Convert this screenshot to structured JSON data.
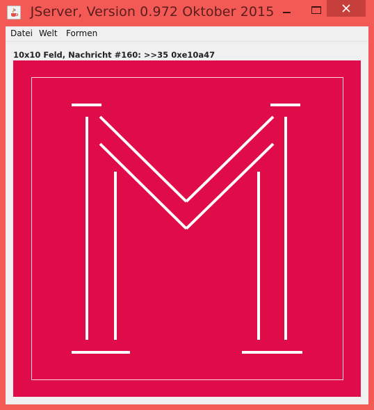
{
  "window": {
    "title": "JServer, Version 0.972 Oktober 2015",
    "icon": "java-cup-icon",
    "controls": [
      "minimize-icon",
      "maximize-icon",
      "close-icon"
    ]
  },
  "menu": {
    "items": [
      "Datei",
      "Welt",
      "Formen"
    ]
  },
  "status": {
    "text": "10x10 Feld, Nachricht #160: >>35 0xe10a47"
  },
  "board": {
    "color": "#e00b49",
    "line_color": "#ffffff"
  },
  "colors": {
    "frame": "#f35a55",
    "close_button": "#c73f3b",
    "panel": "#f0f0f0"
  }
}
